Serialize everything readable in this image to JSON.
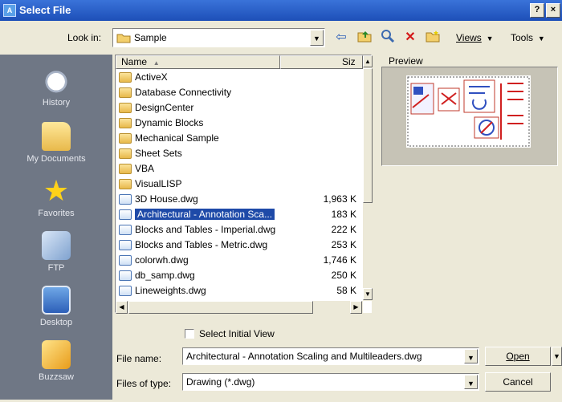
{
  "window": {
    "title": "Select File",
    "help_label": "?",
    "close_label": "×"
  },
  "look_in": {
    "label": "Look in:",
    "value": "Sample"
  },
  "toolbar": {
    "views_label": "Views",
    "tools_label": "Tools"
  },
  "places": [
    "History",
    "My Documents",
    "Favorites",
    "FTP",
    "Desktop",
    "Buzzsaw"
  ],
  "list": {
    "header_name": "Name",
    "header_size": "Siz",
    "rows": [
      {
        "name": "ActiveX",
        "size": "",
        "type": "folder"
      },
      {
        "name": "Database Connectivity",
        "size": "",
        "type": "folder"
      },
      {
        "name": "DesignCenter",
        "size": "",
        "type": "folder"
      },
      {
        "name": "Dynamic Blocks",
        "size": "",
        "type": "folder"
      },
      {
        "name": "Mechanical Sample",
        "size": "",
        "type": "folder"
      },
      {
        "name": "Sheet Sets",
        "size": "",
        "type": "folder"
      },
      {
        "name": "VBA",
        "size": "",
        "type": "folder"
      },
      {
        "name": "VisualLISP",
        "size": "",
        "type": "folder"
      },
      {
        "name": "3D House.dwg",
        "size": "1,963 K",
        "type": "dwg"
      },
      {
        "name": "Architectural - Annotation Sca...",
        "size": "183 K",
        "type": "dwg",
        "selected": true
      },
      {
        "name": "Blocks and Tables - Imperial.dwg",
        "size": "222 K",
        "type": "dwg"
      },
      {
        "name": "Blocks and Tables - Metric.dwg",
        "size": "253 K",
        "type": "dwg"
      },
      {
        "name": "colorwh.dwg",
        "size": "1,746 K",
        "type": "dwg"
      },
      {
        "name": "db_samp.dwg",
        "size": "250 K",
        "type": "dwg"
      },
      {
        "name": "Lineweights.dwg",
        "size": "58 K",
        "type": "dwg"
      }
    ]
  },
  "preview": {
    "label": "Preview"
  },
  "select_initial_view": {
    "label": "Select Initial View",
    "checked": false
  },
  "file_name": {
    "label": "File name:",
    "value": "Architectural - Annotation Scaling and Multileaders.dwg"
  },
  "file_type": {
    "label": "Files of type:",
    "value": "Drawing (*.dwg)"
  },
  "buttons": {
    "open": "Open",
    "cancel": "Cancel"
  }
}
